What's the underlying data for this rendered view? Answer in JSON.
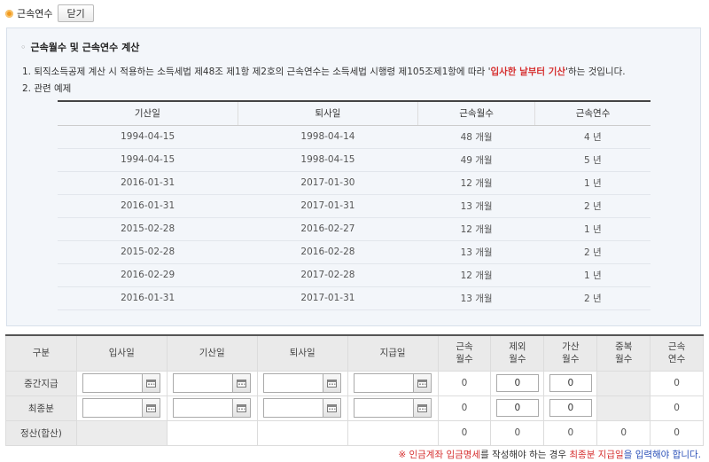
{
  "header": {
    "title": "근속연수",
    "close_label": "닫기"
  },
  "info": {
    "subtitle": "근속월수 및 근속연수 계산",
    "line1_prefix": "1. 퇴직소득공제 계산 시 적용하는 소득세법 제48조 제1항 제2호의 근속연수는 소득세법 시행령 제105조제1항에 따라 '",
    "line1_highlight": "입사한 날부터 기산",
    "line1_suffix": "'하는 것입니다.",
    "line2": "2. 관련 예제"
  },
  "example_table": {
    "headers": [
      "기산일",
      "퇴사일",
      "근속월수",
      "근속연수"
    ],
    "rows": [
      [
        "1994-04-15",
        "1998-04-14",
        "48 개월",
        "4 년"
      ],
      [
        "1994-04-15",
        "1998-04-15",
        "49 개월",
        "5 년"
      ],
      [
        "2016-01-31",
        "2017-01-30",
        "12 개월",
        "1 년"
      ],
      [
        "2016-01-31",
        "2017-01-31",
        "13 개월",
        "2 년"
      ],
      [
        "2015-02-28",
        "2016-02-27",
        "12 개월",
        "1 년"
      ],
      [
        "2015-02-28",
        "2016-02-28",
        "13 개월",
        "2 년"
      ],
      [
        "2016-02-29",
        "2017-02-28",
        "12 개월",
        "1 년"
      ],
      [
        "2016-01-31",
        "2017-01-31",
        "13 개월",
        "2 년"
      ]
    ]
  },
  "input_table": {
    "headers": {
      "category": "구분",
      "join_date": "입사일",
      "start_date": "기산일",
      "leave_date": "퇴사일",
      "pay_date": "지급일",
      "service_months": [
        "근속",
        "월수"
      ],
      "excluded_months": [
        "제외",
        "월수"
      ],
      "added_months": [
        "가산",
        "월수"
      ],
      "overlap_months": [
        "중복",
        "월수"
      ],
      "service_years": [
        "근속",
        "연수"
      ]
    },
    "rows": {
      "interim": {
        "label": "중간지급",
        "service_months": "0",
        "excluded_months": "0",
        "added_months": "0",
        "service_years": "0"
      },
      "final": {
        "label": "최종분",
        "service_months": "0",
        "excluded_months": "0",
        "added_months": "0",
        "service_years": "0"
      },
      "settlement": {
        "label": "정산(합산)",
        "service_months": "0",
        "excluded_months": "0",
        "added_months": "0",
        "overlap_months": "0",
        "service_years": "0"
      }
    }
  },
  "note": {
    "star": "※",
    "part1": "인금계좌 입금명세",
    "part2": "를 작성해야 하는 경우 ",
    "part3": "최종분 지급일",
    "part4": "을 입력해야 합니다."
  },
  "icons": {
    "header_bullet": "orange-bullet-icon",
    "calendar": "calendar-icon"
  },
  "colors": {
    "accent_orange": "#f39a1e",
    "highlight_red": "#d63030",
    "note_blue": "#2a50b8",
    "info_bg": "#f3f6fa"
  }
}
